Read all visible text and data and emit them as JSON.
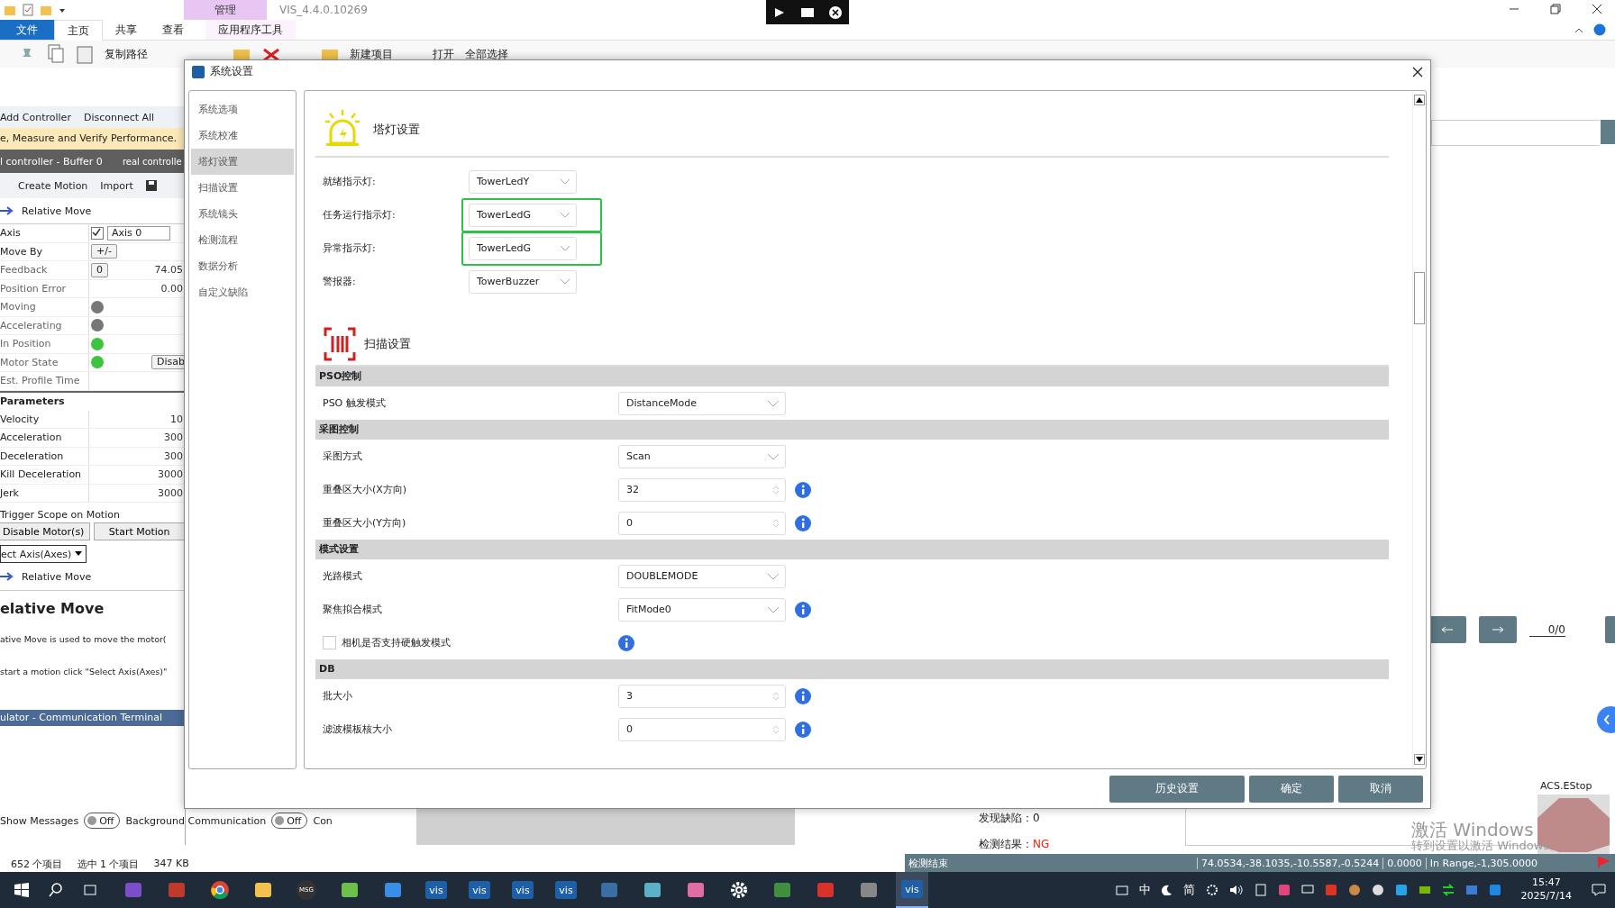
{
  "explorer": {
    "title": "VIS_4.4.0.10269",
    "context_tab": "管理",
    "tabs": [
      {
        "label": "文件",
        "selected": false,
        "kind": "file"
      },
      {
        "label": "主页",
        "selected": true,
        "kind": "tab"
      },
      {
        "label": "共享",
        "selected": false,
        "kind": "tab"
      },
      {
        "label": "查看",
        "selected": false,
        "kind": "tab"
      },
      {
        "label": "应用程序工具",
        "selected": false,
        "kind": "tab"
      }
    ],
    "ribbon": [
      "复制路径",
      "新建项目",
      "打开",
      "全部选择"
    ],
    "status": [
      "652 个项目",
      "选中 1 个项目",
      "347 KB"
    ]
  },
  "acs": {
    "toolbar": [
      "Add Controller",
      "Disconnect All"
    ],
    "banner": "e, Measure and Verify Performance.",
    "tabs": [
      "l controller - Buffer 0",
      "real controlle"
    ],
    "actions": [
      "Create Motion",
      "Import"
    ],
    "section": "Relative Move",
    "rows": [
      {
        "label": "Axis",
        "kind": "axis",
        "checked": true,
        "value": "Axis 0"
      },
      {
        "label": "Move By",
        "kind": "button",
        "value": "+/-"
      },
      {
        "label": "Feedback",
        "kind": "button",
        "value": "0",
        "reading": "74.05"
      },
      {
        "label": "Position Error",
        "kind": "value",
        "reading": "0.00"
      },
      {
        "label": "Moving",
        "kind": "led",
        "on": false
      },
      {
        "label": "Accelerating",
        "kind": "led",
        "on": false
      },
      {
        "label": "In Position",
        "kind": "led",
        "on": true
      },
      {
        "label": "Motor State",
        "kind": "led",
        "on": true,
        "button": "Disab"
      },
      {
        "label": "Est. Profile Time",
        "kind": "value"
      }
    ],
    "parameters_title": "Parameters",
    "parameters": [
      {
        "label": "Velocity",
        "value": "10"
      },
      {
        "label": "Acceleration",
        "value": "300"
      },
      {
        "label": "Deceleration",
        "value": "300"
      },
      {
        "label": "Kill Deceleration",
        "value": "3000"
      },
      {
        "label": "Jerk",
        "value": "3000"
      }
    ],
    "trigger": "Trigger Scope on Motion",
    "buttons": [
      "Disable Motor(s)",
      "Start Motion"
    ],
    "select": "ect Axis(Axes)",
    "section2": "Relative Move",
    "heading": "elative Move",
    "paragraphs": [
      "ative Move is used to move the motor(",
      "start a motion click \"Select Axis(Axes)\""
    ],
    "terminal": "ulator - Communication Terminal",
    "toggles": [
      {
        "label": "Show Messages",
        "value": "Off",
        "on": false
      },
      {
        "label": "Background Communication",
        "value": "Off",
        "on": false
      }
    ],
    "more": "Con"
  },
  "dialog": {
    "title": "系统设置",
    "nav": [
      {
        "label": "系统选项",
        "selected": false
      },
      {
        "label": "系统校准",
        "selected": false
      },
      {
        "label": "塔灯设置",
        "selected": true
      },
      {
        "label": "扫描设置",
        "selected": false
      },
      {
        "label": "系统镜头",
        "selected": false
      },
      {
        "label": "检测流程",
        "selected": false
      },
      {
        "label": "数据分析",
        "selected": false
      },
      {
        "label": "自定义缺陷",
        "selected": false
      }
    ],
    "tower": {
      "title": "塔灯设置",
      "fields": [
        {
          "label": "就绪指示灯:",
          "value": "TowerLedY",
          "highlighted": false
        },
        {
          "label": "任务运行指示灯:",
          "value": "TowerLedG",
          "highlighted": true
        },
        {
          "label": "异常指示灯:",
          "value": "TowerLedG",
          "highlighted": true
        },
        {
          "label": "警报器:",
          "value": "TowerBuzzer",
          "highlighted": false
        }
      ]
    },
    "scan": {
      "title": "扫描设置",
      "groups": [
        {
          "title": "PSO控制",
          "rows": [
            {
              "kind": "select",
              "label": "PSO 触发模式",
              "value": "DistanceMode",
              "info": false
            }
          ]
        },
        {
          "title": "采图控制",
          "rows": [
            {
              "kind": "select",
              "label": "采图方式",
              "value": "Scan",
              "info": false
            },
            {
              "kind": "spin",
              "label": "重叠区大小(X方向)",
              "value": "32",
              "info": true
            },
            {
              "kind": "spin",
              "label": "重叠区大小(Y方向)",
              "value": "0",
              "info": true
            }
          ]
        },
        {
          "title": "模式设置",
          "rows": [
            {
              "kind": "select",
              "label": "光路模式",
              "value": "DOUBLEMODE",
              "info": false
            },
            {
              "kind": "select",
              "label": "聚焦拟合模式",
              "value": "FitMode0",
              "info": true
            },
            {
              "kind": "checkbox",
              "label": "相机是否支持硬触发模式",
              "checked": false,
              "info": true
            }
          ]
        },
        {
          "title": "DB",
          "rows": [
            {
              "kind": "spin",
              "label": "批大小",
              "value": "3",
              "info": true
            },
            {
              "kind": "spin",
              "label": "滤波模板核大小",
              "value": "0",
              "info": true
            }
          ]
        }
      ]
    },
    "buttons": [
      "历史设置",
      "确定",
      "取消"
    ]
  },
  "vis": {
    "defects": "发现缺陷：0",
    "result_label": "检测结果：",
    "result": "NG",
    "pager": "0/0",
    "status": [
      "检测结束",
      "74.0534,-38.1035,-10.5587,-0.5244",
      "0.0000",
      "In Range,-1,305.0000"
    ],
    "estop": "ACS.EStop"
  },
  "activation": [
    "激活 Windows",
    "转到设置以激活 Windows。"
  ],
  "taskbar": {
    "apps": [
      {
        "kind": "vs"
      },
      {
        "kind": "tool"
      },
      {
        "kind": "chrome"
      },
      {
        "kind": "folder"
      },
      {
        "kind": "msg",
        "label": "MSG"
      },
      {
        "kind": "leaf"
      },
      {
        "kind": "store"
      },
      {
        "kind": "vis",
        "label": "vis"
      },
      {
        "kind": "vis",
        "label": "vis"
      },
      {
        "kind": "vis",
        "label": "vis"
      },
      {
        "kind": "vis",
        "label": "vis"
      },
      {
        "kind": "pc"
      },
      {
        "kind": "note"
      },
      {
        "kind": "grid"
      },
      {
        "kind": "gear"
      },
      {
        "kind": "doc"
      },
      {
        "kind": "pdf"
      },
      {
        "kind": "printer"
      },
      {
        "kind": "vis",
        "label": "vis",
        "active": true
      }
    ],
    "ime": [
      "中",
      "简"
    ],
    "time": "15:47",
    "date": "2025/7/14"
  }
}
